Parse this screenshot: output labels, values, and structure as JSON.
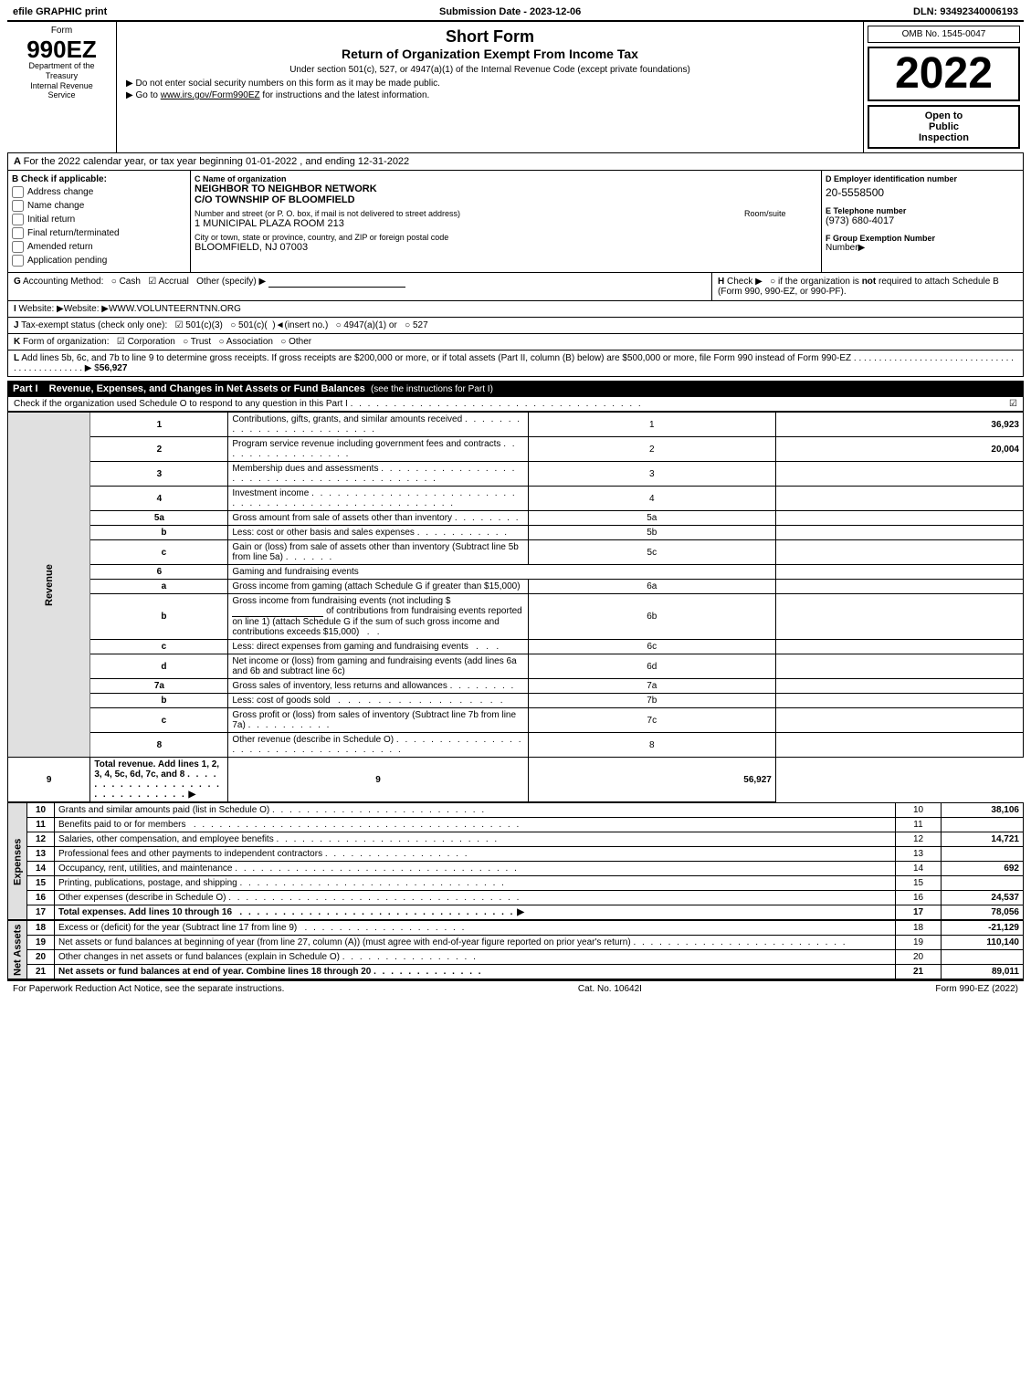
{
  "topbar": {
    "left": "efile GRAPHIC print",
    "center": "Submission Date - 2023-12-06",
    "right": "DLN: 93492340006193"
  },
  "form": {
    "number": "990EZ",
    "department_line1": "Department of the",
    "department_line2": "Treasury",
    "department_line3": "Internal Revenue",
    "department_line4": "Service",
    "omb": "OMB No. 1545-0047",
    "year": "2022",
    "open_inspection": {
      "line1": "Open to",
      "line2": "Public",
      "line3": "Inspection"
    },
    "short_form_title": "Short Form",
    "return_title": "Return of Organization Exempt From Income Tax",
    "subtitle": "Under section 501(c), 527, or 4947(a)(1) of the Internal Revenue Code (except private foundations)",
    "bullet1": "▶ Do not enter social security numbers on this form as it may be made public.",
    "bullet2": "▶ Go to www.irs.gov/Form990EZ for instructions and the latest information."
  },
  "section_a": {
    "label": "A",
    "text": "For the 2022 calendar year, or tax year beginning 01-01-2022 , and ending 12-31-2022"
  },
  "section_b": {
    "label": "B",
    "sublabel": "Check if applicable:",
    "checkboxes": [
      {
        "id": "address_change",
        "label": "Address change",
        "checked": false
      },
      {
        "id": "name_change",
        "label": "Name change",
        "checked": false
      },
      {
        "id": "initial_return",
        "label": "Initial return",
        "checked": false
      },
      {
        "id": "final_return",
        "label": "Final return/terminated",
        "checked": false
      },
      {
        "id": "amended_return",
        "label": "Amended return",
        "checked": false
      },
      {
        "id": "app_pending",
        "label": "Application pending",
        "checked": false
      }
    ]
  },
  "section_c": {
    "label": "C",
    "sublabel": "Name of organization",
    "org_name": "NEIGHBOR TO NEIGHBOR NETWORK",
    "org_name2": "C/O TOWNSHIP OF BLOOMFIELD",
    "address_label": "Number and street (or P. O. box, if mail is not delivered to street address)",
    "address": "1 MUNICIPAL PLAZA ROOM 213",
    "room_suite_label": "Room/suite",
    "city_label": "City or town, state or province, country, and ZIP or foreign postal code",
    "city": "BLOOMFIELD, NJ  07003"
  },
  "section_d": {
    "label": "D",
    "sublabel": "Employer identification number",
    "ein": "20-5558500",
    "e_label": "E Telephone number",
    "phone": "(973) 680-4017",
    "f_label": "F Group Exemption Number",
    "f_arrow": "▶"
  },
  "section_g": {
    "label": "G",
    "text": "Accounting Method:",
    "cash_label": "Cash",
    "accrual_label": "Accrual",
    "other_label": "Other (specify) ▶",
    "accrual_checked": true
  },
  "section_h": {
    "label": "H",
    "text": "Check ▶  ○ if the organization is not required to attach Schedule B (Form 990, 990-EZ, or 990-PF)."
  },
  "section_i": {
    "label": "I",
    "text": "Website: ▶WWW.VOLUNTEERNTNN.ORG"
  },
  "section_j": {
    "label": "J",
    "text": "Tax-exempt status (check only one): ☑ 501(c)(3)  ○ 501(c)(  )◄(insert no.)  ○ 4947(a)(1) or  ○ 527"
  },
  "section_k": {
    "label": "K",
    "text": "Form of organization: ☑ Corporation  ○ Trust  ○ Association  ○ Other"
  },
  "section_l": {
    "label": "L",
    "text": "Add lines 5b, 6c, and 7b to line 9 to determine gross receipts. If gross receipts are $200,000 or more, or if total assets (Part II, column (B) below) are $500,000 or more, file Form 990 instead of Form 990-EZ",
    "dots": ". . . . . . . . . . . . . . . . . . . . . . . . . . . . . . . . . . . . . . . . . . . . . . .",
    "arrow": "▶ $",
    "value": "56,927"
  },
  "part1": {
    "label": "Part I",
    "title": "Revenue, Expenses, and Changes in Net Assets or Fund Balances",
    "subtitle": "(see the instructions for Part I)",
    "check_text": "Check if the organization used Schedule O to respond to any question in this Part I",
    "check_dots": ". . . . . . . . . . . . . . . . . . . . . . . . . . . . . . . . . .",
    "rows": [
      {
        "num": "1",
        "desc": "Contributions, gifts, grants, and similar amounts received . . . . . . . . . . . . . . . . . . . . . . . . .",
        "ref": "",
        "val": "36,923"
      },
      {
        "num": "2",
        "desc": "Program service revenue including government fees and contracts . . . . . . . . . . . . . . . . . .",
        "ref": "",
        "val": "20,004"
      },
      {
        "num": "3",
        "desc": "Membership dues and assessments . . . . . . . . . . . . . . . . . . . . . . . . . . . . . . . . . . . . . . .",
        "ref": "",
        "val": ""
      },
      {
        "num": "4",
        "desc": "Investment income . . . . . . . . . . . . . . . . . . . . . . . . . . . . . . . . . . . . . . . . . . . . . . . . . .",
        "ref": "",
        "val": ""
      },
      {
        "num": "5a",
        "desc": "Gross amount from sale of assets other than inventory . . . . . . . .",
        "ref": "5a",
        "val": ""
      },
      {
        "num": "5b",
        "desc": "Less: cost or other basis and sales expenses . . . . . . . . . . . .",
        "ref": "5b",
        "val": ""
      },
      {
        "num": "5c",
        "desc": "Gain or (loss) from sale of assets other than inventory (Subtract line 5b from line 5a) . . . . . . .",
        "ref": "5c",
        "val": ""
      },
      {
        "num": "6",
        "desc": "Gaming and fundraising events",
        "ref": "",
        "val": ""
      },
      {
        "num": "6a",
        "desc": "Gross income from gaming (attach Schedule G if greater than $15,000)",
        "ref": "6a",
        "val": ""
      },
      {
        "num": "6b",
        "desc": "Gross income from fundraising events (not including $                             of contributions from fundraising events reported on line 1) (attach Schedule G if the sum of such gross income and contributions exceeds $15,000)   .   .",
        "ref": "6b",
        "val": ""
      },
      {
        "num": "6c",
        "desc": "Less: direct expenses from gaming and fundraising events   .   .   .",
        "ref": "6c",
        "val": ""
      },
      {
        "num": "6d",
        "desc": "Net income or (loss) from gaming and fundraising events (add lines 6a and 6b and subtract line 6c)",
        "ref": "6d",
        "val": ""
      },
      {
        "num": "7a",
        "desc": "Gross sales of inventory, less returns and allowances . . . . . . . .",
        "ref": "7a",
        "val": ""
      },
      {
        "num": "7b",
        "desc": "Less: cost of goods sold    .  .  .  .  .  .  .  .  .  .  .  .  .  .  .  .  .  .",
        "ref": "7b",
        "val": ""
      },
      {
        "num": "7c",
        "desc": "Gross profit or (loss) from sales of inventory (Subtract line 7b from line 7a) . . . . . . . . . . .",
        "ref": "7c",
        "val": ""
      },
      {
        "num": "8",
        "desc": "Other revenue (describe in Schedule O) . . . . . . . . . . . . . . . . . . . . . . . . . . . . . . . . . . .",
        "ref": "",
        "val": ""
      },
      {
        "num": "9",
        "desc": "Total revenue. Add lines 1, 2, 3, 4, 5c, 6d, 7c, and 8",
        "ref": "",
        "val": "56,927",
        "bold": true,
        "arrow": true
      }
    ]
  },
  "expenses": {
    "rows": [
      {
        "num": "10",
        "desc": "Grants and similar amounts paid (list in Schedule O) . . . . . . . . . . . . . . . . . . . . . . . . . . .",
        "val": "38,106"
      },
      {
        "num": "11",
        "desc": "Benefits paid to or for members   . . . . . . . . . . . . . . . . . . . . . . . . . . . . . . . . . . . . . . .",
        "val": ""
      },
      {
        "num": "12",
        "desc": "Salaries, other compensation, and employee benefits . . . . . . . . . . . . . . . . . . . . . . . . . . .",
        "val": "14,721"
      },
      {
        "num": "13",
        "desc": "Professional fees and other payments to independent contractors . . . . . . . . . . . . . . . . . . .",
        "val": ""
      },
      {
        "num": "14",
        "desc": "Occupancy, rent, utilities, and maintenance . . . . . . . . . . . . . . . . . . . . . . . . . . . . . . . . .",
        "val": "692"
      },
      {
        "num": "15",
        "desc": "Printing, publications, postage, and shipping . . . . . . . . . . . . . . . . . . . . . . . . . . . . . . . .",
        "val": ""
      },
      {
        "num": "16",
        "desc": "Other expenses (describe in Schedule O) . . . . . . . . . . . . . . . . . . . . . . . . . . . . . . . . . .",
        "val": "24,537"
      },
      {
        "num": "17",
        "desc": "Total expenses. Add lines 10 through 16    . . . . . . . . . . . . . . . . . . . . . . . . . . . . . . . .",
        "val": "78,056",
        "bold": true,
        "arrow": true
      }
    ]
  },
  "net_assets": {
    "rows": [
      {
        "num": "18",
        "desc": "Excess or (deficit) for the year (Subtract line 17 from line 9)    . . . . . . . . . . . . . . . . . . .",
        "val": "-21,129"
      },
      {
        "num": "19",
        "desc": "Net assets or fund balances at beginning of year (from line 27, column (A)) (must agree with end-of-year figure reported on prior year's return) . . . . . . . . . . . . . . . . . . . . . . . . . .",
        "val": "110,140"
      },
      {
        "num": "20",
        "desc": "Other changes in net assets or fund balances (explain in Schedule O) . . . . . . . . . . . . . . .",
        "val": ""
      },
      {
        "num": "21",
        "desc": "Net assets or fund balances at end of year. Combine lines 18 through 20 . . . . . . . . . . . . .",
        "val": "89,011",
        "bold": true
      }
    ]
  },
  "footer": {
    "paperwork": "For Paperwork Reduction Act Notice, see the separate instructions.",
    "cat": "Cat. No. 10642I",
    "form_ref": "Form 990-EZ (2022)"
  }
}
